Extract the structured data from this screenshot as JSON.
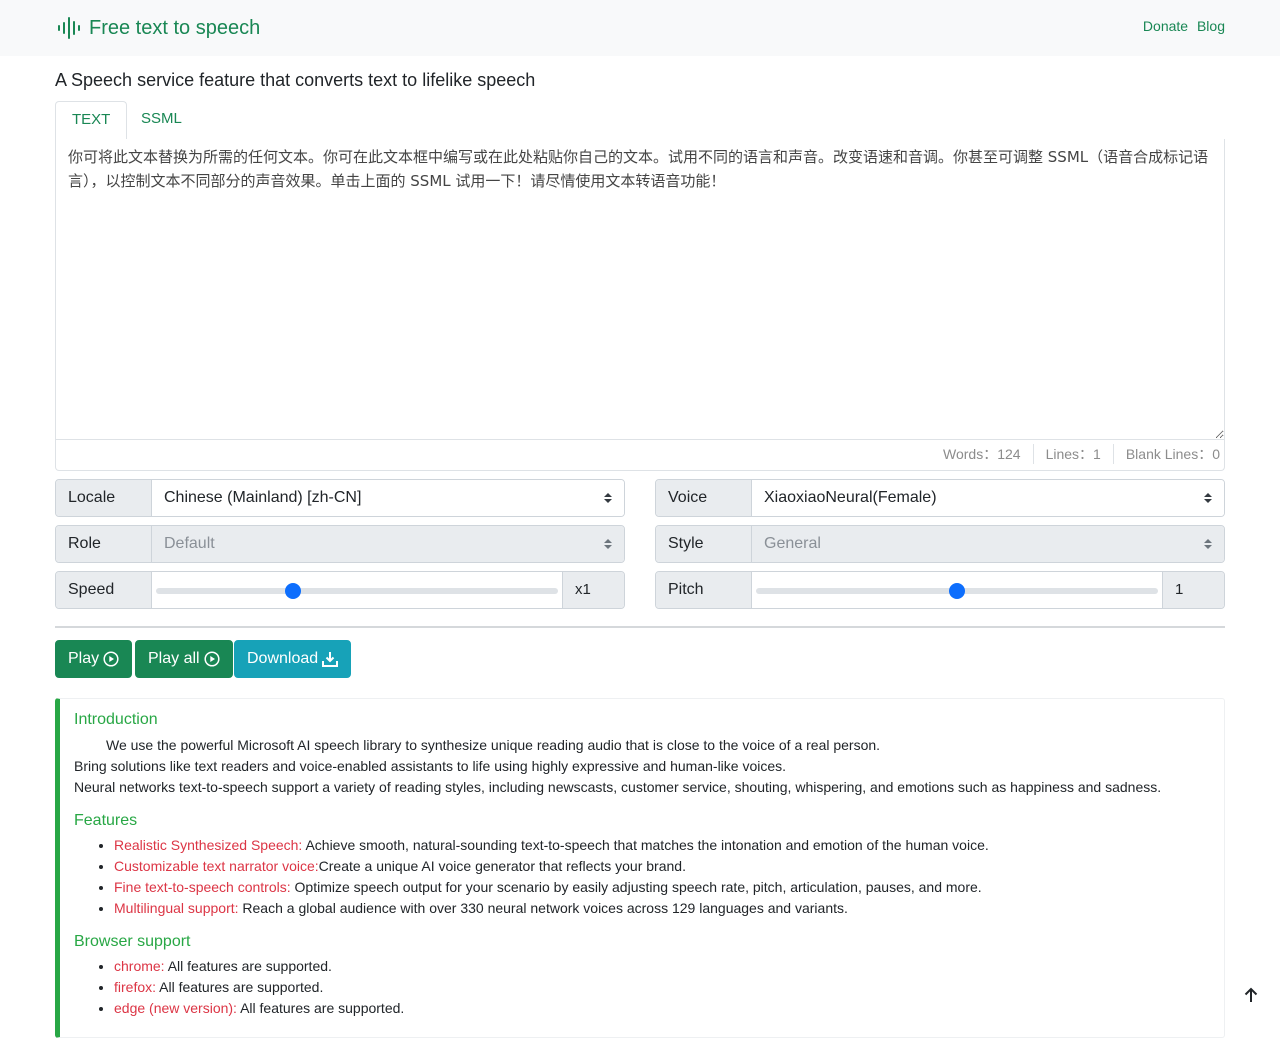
{
  "header": {
    "brand": "Free text to speech",
    "links": [
      "Donate",
      "Blog"
    ]
  },
  "tagline": "A Speech service feature that converts text to lifelike speech",
  "tabs": [
    "TEXT",
    "SSML"
  ],
  "editor": {
    "text": "你可将此文本替换为所需的任何文本。你可在此文本框中编写或在此处粘贴你自己的文本。试用不同的语言和声音。改变语速和音调。你甚至可调整 SSML（语音合成标记语言），以控制文本不同部分的声音效果。单击上面的 SSML 试用一下！请尽情使用文本转语音功能！"
  },
  "stats": {
    "words": "Words：124",
    "lines": "Lines：1",
    "blank_lines": "Blank Lines：0"
  },
  "controls": {
    "locale_label": "Locale",
    "locale_value": "Chinese (Mainland) [zh-CN]",
    "voice_label": "Voice",
    "voice_value": "XiaoxiaoNeural(Female)",
    "role_label": "Role",
    "role_value": "Default",
    "style_label": "Style",
    "style_value": "General",
    "speed_label": "Speed",
    "speed_value": "x1",
    "speed_position": 0.34,
    "pitch_label": "Pitch",
    "pitch_value": "1",
    "pitch_position": 0.5
  },
  "buttons": {
    "play": "Play",
    "play_all": "Play all",
    "download": "Download"
  },
  "info": {
    "intro_title": "Introduction",
    "intro_lines": [
      "We use the powerful Microsoft AI speech library to synthesize unique reading audio that is close to the voice of a real person.",
      "Bring solutions like text readers and voice-enabled assistants to life using highly expressive and human-like voices.",
      "Neural networks text-to-speech support a variety of reading styles, including newscasts, customer service, shouting, whispering, and emotions such as happiness and sadness."
    ],
    "features_title": "Features",
    "features": [
      {
        "name": "Realistic Synthesized Speech:",
        "text": " Achieve smooth, natural-sounding text-to-speech that matches the intonation and emotion of the human voice."
      },
      {
        "name": "Customizable text narrator voice:",
        "text": "Create a unique AI voice generator that reflects your brand."
      },
      {
        "name": "Fine text-to-speech controls:",
        "text": " Optimize speech output for your scenario by easily adjusting speech rate, pitch, articulation, pauses, and more."
      },
      {
        "name": "Multilingual support:",
        "text": " Reach a global audience with over 330 neural network voices across 129 languages and variants."
      }
    ],
    "browser_title": "Browser support",
    "browsers": [
      {
        "name": "chrome:",
        "text": " All features are supported."
      },
      {
        "name": "firefox:",
        "text": " All features are supported."
      },
      {
        "name": "edge (new version):",
        "text": " All features are supported."
      }
    ]
  },
  "colors": {
    "brand_green": "#198754",
    "info_green": "#28a745",
    "download_teal": "#17a2b8",
    "highlight_red": "#dc3545",
    "slider_blue": "#0d6efd"
  },
  "icons": [
    "soundwave-icon",
    "play-circle-icon",
    "download-icon",
    "arrow-up-icon",
    "select-arrows-icon"
  ]
}
